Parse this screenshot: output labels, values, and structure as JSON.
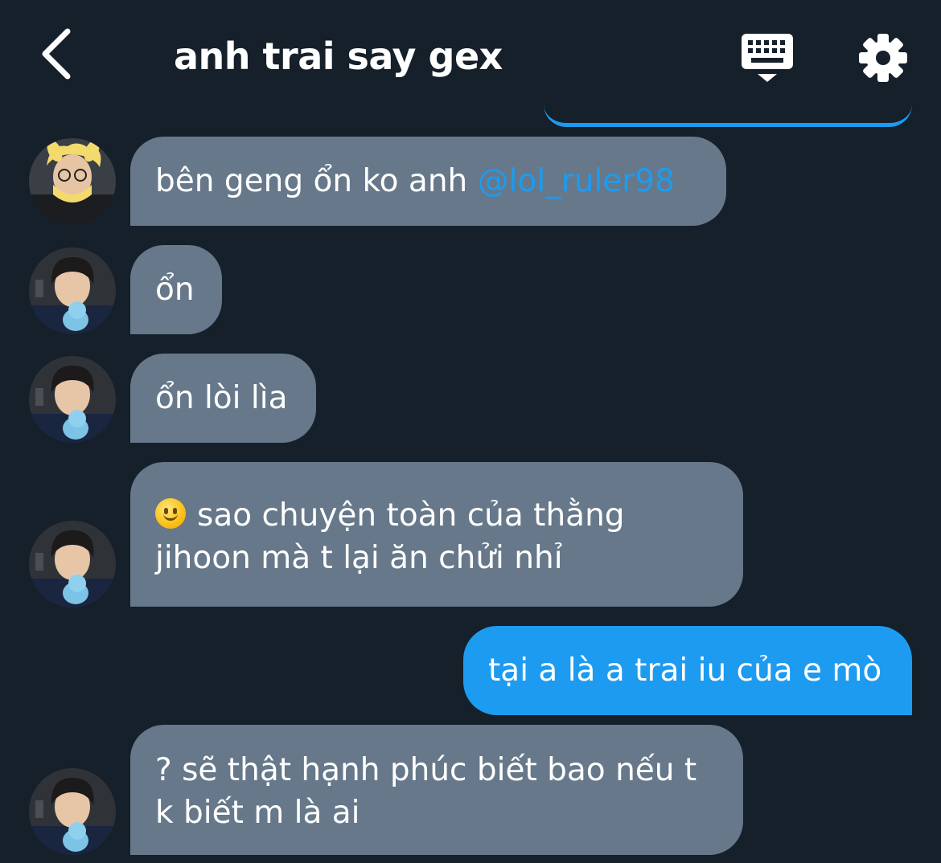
{
  "header": {
    "title": "anh trai say gex",
    "back_icon": "chevron-left-icon",
    "keyboard_icon": "keyboard-icon",
    "settings_icon": "gear-icon"
  },
  "colors": {
    "background": "#15202b",
    "received_bubble": "#66788a",
    "sent_bubble": "#1d9bf0",
    "mention": "#1d9bf0"
  },
  "messages": [
    {
      "sender": "other-1",
      "text_before": "bên geng ổn ko anh ",
      "mention": "@lol_ruler98"
    },
    {
      "sender": "other-2",
      "text": "ổn"
    },
    {
      "sender": "other-2",
      "text": "ổn lòi lìa"
    },
    {
      "sender": "other-2",
      "emoji": "slightly-smiling-face",
      "line1": "sao chuyện toàn của thằng",
      "line2": "jihoon mà t lại ăn chửi nhỉ"
    },
    {
      "sender": "me",
      "text": "tại a là a trai iu của e mò"
    },
    {
      "sender": "other-2",
      "line1": "? sẽ thật hạnh phúc biết bao nếu t",
      "line2": "k biết m là ai"
    }
  ]
}
